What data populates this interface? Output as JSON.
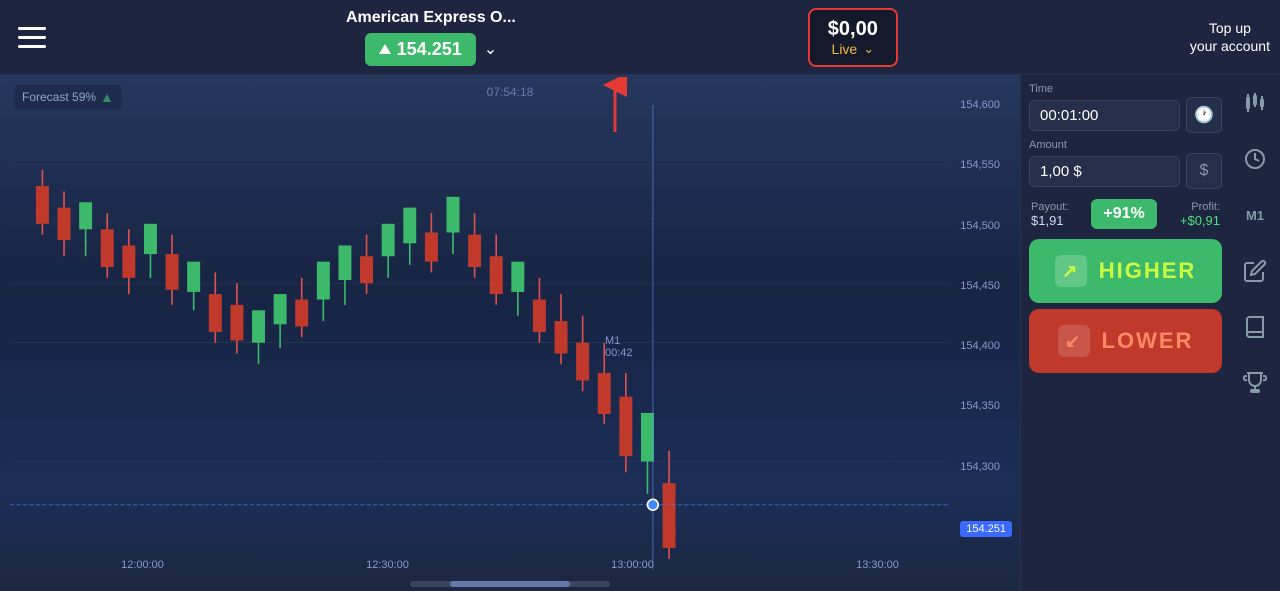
{
  "header": {
    "menu_label": "menu",
    "asset_name": "American Express O...",
    "asset_price": "154.251",
    "balance_amount": "$0,00",
    "live_label": "Live",
    "top_up_line1": "Top up",
    "top_up_line2": "your account"
  },
  "right_panel": {
    "time_label": "Time",
    "time_value": "00:01:00",
    "amount_label": "Amount",
    "amount_value": "1,00 $",
    "currency_symbol": "$",
    "payout_label": "Payout:",
    "payout_value": "$1,91",
    "payout_pct": "+91%",
    "profit_label": "Profit:",
    "profit_value": "+$0,91",
    "higher_label": "HIGHER",
    "lower_label": "LOWER",
    "m1_badge": "M1"
  },
  "chart": {
    "forecast_label": "Forecast 59%",
    "time_label": "07:54:18",
    "m1_label": "M1",
    "countdown": "00:42",
    "price_line_value": "154.251",
    "y_prices": [
      "154,600",
      "154,550",
      "154,500",
      "154,450",
      "154,400",
      "154,350",
      "154,300"
    ],
    "x_times": [
      "12:00:00",
      "12:30:00",
      "13:00:00",
      "13:30:00"
    ]
  },
  "side_icons": {
    "candlestick_icon": "📊",
    "clock_icon": "🕐",
    "m1_label": "M1",
    "edit_icon": "✏️",
    "book_icon": "📖",
    "trophy_icon": "🏆"
  }
}
